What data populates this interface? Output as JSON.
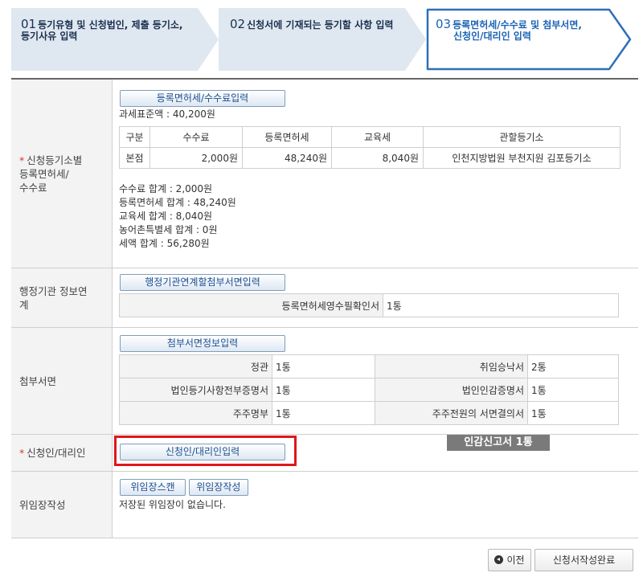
{
  "steps": [
    {
      "num": "01",
      "line1": "등기유형 및 신청법인, 제출 등기소,",
      "line2": "등기사유 입력"
    },
    {
      "num": "02",
      "line1": "신청서에 기재되는 등기할 사항 입력",
      "line2": ""
    },
    {
      "num": "03",
      "line1": "등록면허세/수수료 및 첨부서면,",
      "line2": "신청인/대리인 입력"
    }
  ],
  "fee_section": {
    "label_required": "*",
    "label_lines": [
      "신청등기소별",
      "등록면허세/",
      "수수료"
    ],
    "button": "등록면허세/수수료입력",
    "base": "과세표준액 : 40,200원",
    "headers": [
      "구분",
      "수수료",
      "등록면허세",
      "교육세",
      "관할등기소"
    ],
    "rows": [
      [
        "본점",
        "2,000원",
        "48,240원",
        "8,040원",
        "인천지방법원 부천지원 김포등기소"
      ]
    ],
    "summary": [
      "수수료 합계 : 2,000원",
      "등록면허세 합계 : 48,240원",
      "교육세 합계 : 8,040원",
      "농어촌특별세 합계 : 0원",
      "세액 합계 : 56,280원"
    ]
  },
  "agency_section": {
    "label_lines": [
      "행정기관 정보연",
      "계"
    ],
    "button": "행정기관연계할첨부서면입력",
    "key": "등록면허세영수필확인서",
    "value": "1통"
  },
  "attach_section": {
    "label": "첨부서면",
    "button": "첨부서면정보입력",
    "items": [
      {
        "key": "정관",
        "value": "1통"
      },
      {
        "key": "취임승낙서",
        "value": "2통"
      },
      {
        "key": "법인등기사항전부증명서",
        "value": "1통"
      },
      {
        "key": "법인인감증명서",
        "value": "1통"
      },
      {
        "key": "주주명부",
        "value": "1통"
      },
      {
        "key": "주주전원의 서면결의서",
        "value": "1통"
      }
    ]
  },
  "applicant_section": {
    "label_required": "*",
    "label": "신청인/대리인",
    "button": "신청인/대리인입력",
    "seal_label": "인감신고서  1통"
  },
  "poa_section": {
    "label": "위임장작성",
    "scan_button": "위임장스캔",
    "write_button": "위임장작성",
    "message": "저장된 위임장이 없습니다."
  },
  "footer": {
    "prev": "이전",
    "complete": "신청서작성완료"
  },
  "colors": {
    "step_fill": "#dfe8f0",
    "active_border": "#2f6fb8",
    "highlight": "#e0161b"
  }
}
